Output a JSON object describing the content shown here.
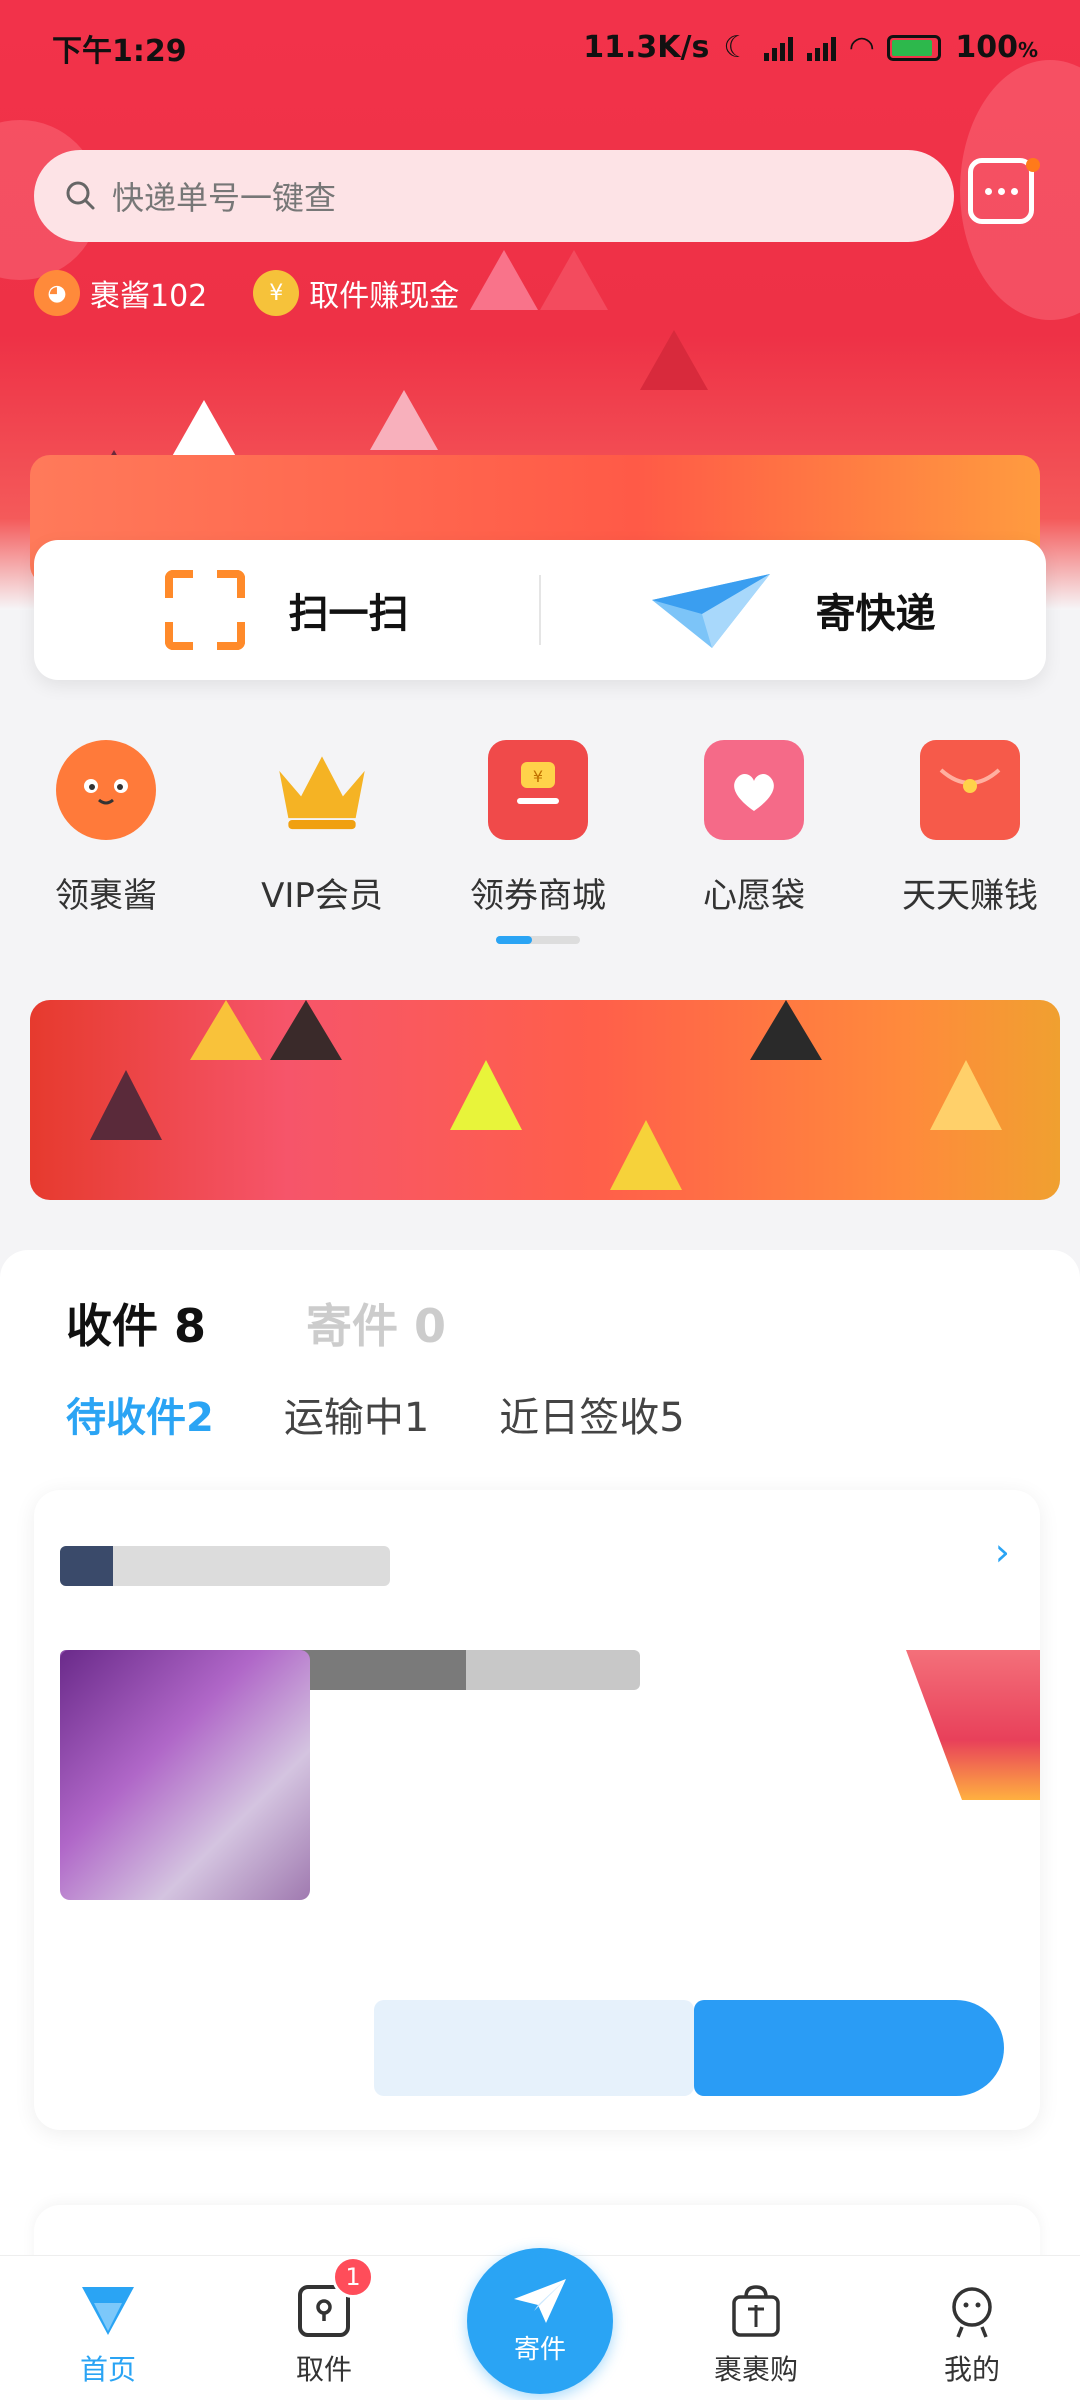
{
  "status_bar": {
    "time": "下午1:29",
    "network_speed": "11.3K/s",
    "battery": "100",
    "battery_unit": "%"
  },
  "header": {
    "search_placeholder": "快递单号一键查",
    "chips": [
      {
        "label": "裹酱102",
        "icon": "mascot-icon"
      },
      {
        "label": "取件赚现金",
        "icon": "yuan-coin-icon"
      }
    ]
  },
  "actions": {
    "scan_label": "扫一扫",
    "send_label": "寄快递"
  },
  "quick_items": [
    {
      "label": "领裹酱",
      "icon": "mascot-face-icon",
      "color": "#ff7a3a"
    },
    {
      "label": "VIP会员",
      "icon": "crown-icon",
      "color": "#f5b324"
    },
    {
      "label": "领券商城",
      "icon": "coupon-box-icon",
      "color": "#f04a4a"
    },
    {
      "label": "心愿袋",
      "icon": "heart-bag-icon",
      "color": "#f56a88"
    },
    {
      "label": "天天赚钱",
      "icon": "red-envelope-icon",
      "color": "#f65a4a"
    }
  ],
  "parcels": {
    "tab_receive": "收件",
    "tab_receive_count": "8",
    "tab_send": "寄件",
    "tab_send_count": "0",
    "sub_tabs": [
      {
        "label": "待收件",
        "count": "2"
      },
      {
        "label": "运输中",
        "count": "1"
      },
      {
        "label": "近日签收",
        "count": "5"
      }
    ]
  },
  "bottom_nav": {
    "items": [
      {
        "label": "首页",
        "active": true
      },
      {
        "label": "取件",
        "badge": "1"
      },
      {
        "label": "寄件"
      },
      {
        "label": "裹裹购"
      },
      {
        "label": "我的"
      }
    ]
  },
  "colors": {
    "brand_red": "#ee3146",
    "accent_blue": "#2aa4f4"
  }
}
